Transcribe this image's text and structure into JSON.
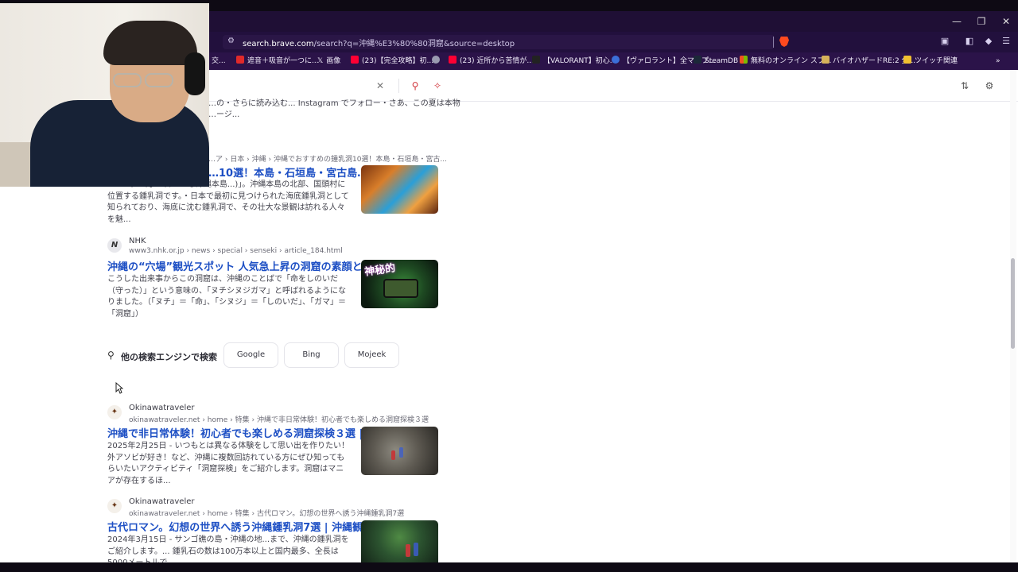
{
  "browser": {
    "url_host": "search.brave.com",
    "url_path": "/search?q=沖縄%E3%80%80洞窟&source=desktop",
    "window_controls": [
      "—",
      "❐",
      "✕"
    ]
  },
  "bookmarks": [
    {
      "label": "交...",
      "color": "#6b4fb0"
    },
    {
      "label": "遮音＋吸音が一つに...",
      "color": "#e02a2a"
    },
    {
      "label": "画像",
      "color": "#ffffff"
    },
    {
      "label": "(23)【完全攻略】初...",
      "color": "#ff0033"
    },
    {
      "label": "",
      "color": "#9a9ab0"
    },
    {
      "label": "(23) 近所から苦情が...",
      "color": "#ff0033"
    },
    {
      "label": "【VALORANT】初心...",
      "color": "#222222"
    },
    {
      "label": "【ヴァロラント】全マップ...",
      "color": "#3b6fd8"
    },
    {
      "label": "SteamDB",
      "color": "#1b2838"
    },
    {
      "label": "無料のオンライン スプ...",
      "color": "#3cb043"
    },
    {
      "label": "バイオハザードRE:2 全...",
      "color": "#d6b25a"
    },
    {
      "label": "ツイッチ関連",
      "color": "#f0c030"
    }
  ],
  "top_result_fragment": {
    "desc_line1": "…の・さらに読み込む... Instagram でフォロー・さあ、この夏は本物",
    "desc_line2": "…ージ..."
  },
  "results": [
    {
      "crumb": "…ア › 日本 › 沖縄 › 沖縄でおすすめの鍾乳洞10選！本島・石垣島・宮古...",
      "title": "…10選！本島・石垣島・宮古島…",
      "desc": "2025年12月26日 - …る沖縄本島...)」。沖縄本島の北部、国頭村に位置する鍾乳洞です。・日本で最初に見つけられた海底鍾乳洞として知られており、海底に沈む鍾乳洞で、その壮大な景観は訪れる人々を魅..."
    },
    {
      "site": "NHK",
      "crumb": "www3.nhk.or.jp › news › special › senseki › article_184.html",
      "title": "沖縄の“穴場”観光スポット 人気急上昇の洞窟の素顔と…",
      "desc": "こうした出来事からこの洞窟は、沖縄のことばで「命をしのいだ（守った）」という意味の、「ヌチシヌジガマ」と呼ばれるようになりました。（「ヌチ」＝「命」、「シヌジ」＝「しのいだ」、「ガマ」＝「洞窟」）",
      "thumb_caption": "神秘的"
    },
    {
      "site": "Okinawatraveler",
      "crumb": "okinawatraveler.net  › home › 特集 › 沖縄で非日常体験！初心者でも楽しめる洞窟探検３選",
      "title": "沖縄で非日常体験！初心者でも楽しめる洞窟探検３選 |…",
      "desc": "2025年2月25日 - いつもとは異なる体験をして思い出を作りたい！外アソビが好き！など、沖縄に複数回訪れている方にぜひ知ってもらいたいアクティビティ「洞窟探検」をご紹介します。洞窟はマニアが存在するほ..."
    },
    {
      "site": "Okinawatraveler",
      "crumb": "okinawatraveler.net  › home › 特集 › 古代ロマン。幻想の世界へ誘う沖縄鍾乳洞7選",
      "title": "古代ロマン。幻想の世界へ誘う沖縄鍾乳洞7選 | 沖縄観…",
      "desc": "2024年3月15日 - サンゴ礁の島・沖縄の地...まで、沖縄の鍾乳洞をご紹介します。... 鍾乳石の数は100万本以上と国内最多、全長は5000メートルで"
    }
  ],
  "other_engines": {
    "label": "他の検索エンジンで検索",
    "buttons": [
      "Google",
      "Bing",
      "Mojeek"
    ]
  }
}
